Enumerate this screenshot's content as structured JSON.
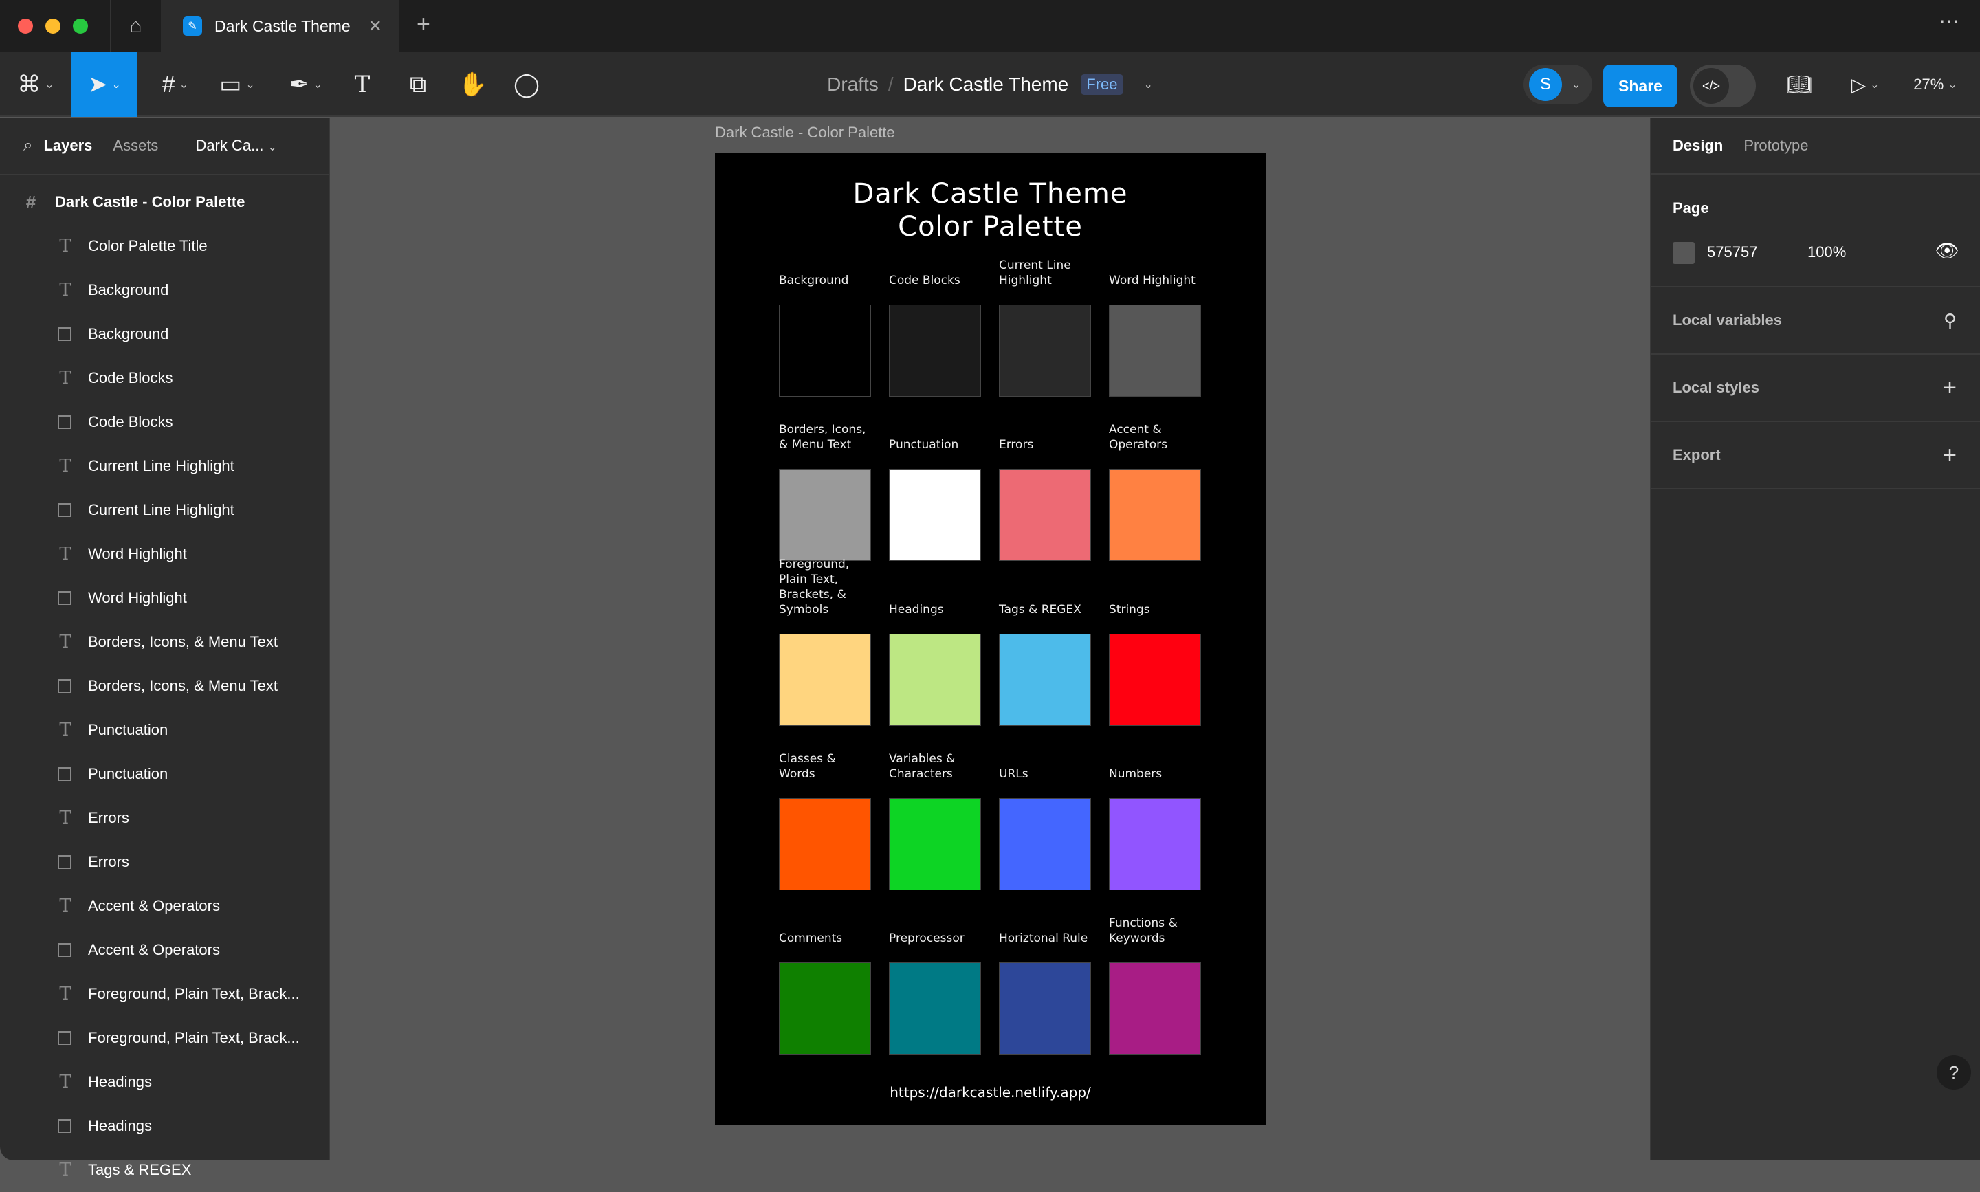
{
  "window": {
    "tab_title": "Dark Castle Theme",
    "traffic_colors": [
      "#ff5f57",
      "#febc2e",
      "#28c840"
    ]
  },
  "toolbar": {
    "breadcrumb_parent": "Drafts",
    "breadcrumb_sep": "/",
    "file_name": "Dark Castle Theme",
    "plan_badge": "Free",
    "avatar_initial": "S",
    "share_label": "Share",
    "zoom": "27%",
    "accent": "#0d8ce9"
  },
  "left_panel": {
    "tabs": [
      "Layers",
      "Assets"
    ],
    "page_selector": "Dark Ca...",
    "frame_name": "Dark Castle - Color Palette",
    "layers": [
      {
        "type": "text",
        "name": "Color Palette Title"
      },
      {
        "type": "text",
        "name": "Background"
      },
      {
        "type": "rect",
        "name": "Background"
      },
      {
        "type": "text",
        "name": "Code Blocks"
      },
      {
        "type": "rect",
        "name": "Code Blocks"
      },
      {
        "type": "text",
        "name": "Current Line Highlight"
      },
      {
        "type": "rect",
        "name": "Current Line Highlight"
      },
      {
        "type": "text",
        "name": "Word Highlight"
      },
      {
        "type": "rect",
        "name": "Word Highlight"
      },
      {
        "type": "text",
        "name": "Borders, Icons, & Menu Text"
      },
      {
        "type": "rect",
        "name": "Borders, Icons, & Menu Text"
      },
      {
        "type": "text",
        "name": "Punctuation"
      },
      {
        "type": "rect",
        "name": "Punctuation"
      },
      {
        "type": "text",
        "name": "Errors"
      },
      {
        "type": "rect",
        "name": "Errors"
      },
      {
        "type": "text",
        "name": "Accent & Operators"
      },
      {
        "type": "rect",
        "name": "Accent & Operators"
      },
      {
        "type": "text",
        "name": "Foreground, Plain Text, Brack..."
      },
      {
        "type": "rect",
        "name": "Foreground, Plain Text, Brack..."
      },
      {
        "type": "text",
        "name": "Headings"
      },
      {
        "type": "rect",
        "name": "Headings"
      },
      {
        "type": "text",
        "name": "Tags & REGEX"
      }
    ]
  },
  "canvas": {
    "frame_label": "Dark Castle - Color Palette",
    "title_line1": "Dark Castle Theme",
    "title_line2": "Color Palette",
    "url": "https://darkcastle.netlify.app/",
    "swatches": [
      {
        "label": "Background",
        "color": "#000000"
      },
      {
        "label": "Code Blocks",
        "color": "#1b1b1b"
      },
      {
        "label": "Current Line Highlight",
        "color": "#292929"
      },
      {
        "label": "Word Highlight",
        "color": "#575757"
      },
      {
        "label": "Borders, Icons, & Menu Text",
        "color": "#9a9a9a"
      },
      {
        "label": "Punctuation",
        "color": "#ffffff"
      },
      {
        "label": "Errors",
        "color": "#ed6a74"
      },
      {
        "label": "Accent & Operators",
        "color": "#ff8142"
      },
      {
        "label": "Foreground, Plain Text, Brackets, & Symbols",
        "color": "#ffd57f"
      },
      {
        "label": "Headings",
        "color": "#bde783"
      },
      {
        "label": "Tags & REGEX",
        "color": "#4dbbea"
      },
      {
        "label": "Strings",
        "color": "#ff0010"
      },
      {
        "label": "Classes & Words",
        "color": "#ff5500"
      },
      {
        "label": "Variables & Characters",
        "color": "#0dd424"
      },
      {
        "label": "URLs",
        "color": "#4466ff"
      },
      {
        "label": "Numbers",
        "color": "#9155ff"
      },
      {
        "label": "Comments",
        "color": "#0f8000"
      },
      {
        "label": "Preprocessor",
        "color": "#007a85"
      },
      {
        "label": "Horiztonal Rule",
        "color": "#2d4799"
      },
      {
        "label": "Functions & Keywords",
        "color": "#a81d85"
      }
    ]
  },
  "right_panel": {
    "tabs": [
      "Design",
      "Prototype"
    ],
    "page_title": "Page",
    "page_color": "575757",
    "page_color_hex": "#575757",
    "page_opacity": "100%",
    "local_variables": "Local variables",
    "local_styles": "Local styles",
    "export": "Export"
  },
  "help": "?"
}
